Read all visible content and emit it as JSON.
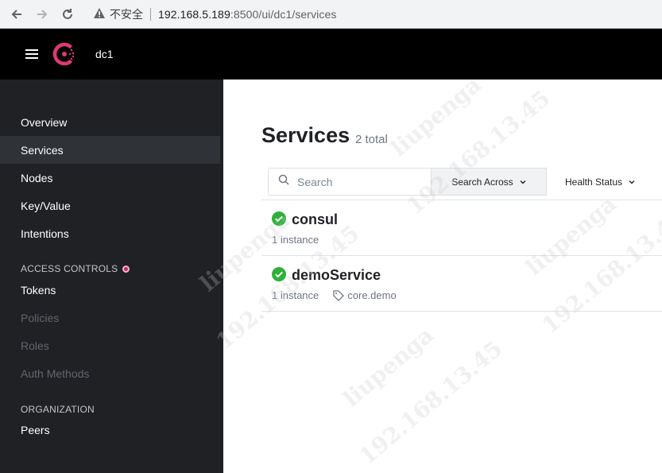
{
  "browser": {
    "security_label": "不安全",
    "url_host": "192.168.5.189",
    "url_rest": ":8500/ui/dc1/services"
  },
  "header": {
    "datacenter": "dc1"
  },
  "sidebar": {
    "items": [
      {
        "label": "Overview"
      },
      {
        "label": "Services"
      },
      {
        "label": "Nodes"
      },
      {
        "label": "Key/Value"
      },
      {
        "label": "Intentions"
      }
    ],
    "access_controls_heading": "ACCESS CONTROLS",
    "access_items": [
      {
        "label": "Tokens"
      },
      {
        "label": "Policies"
      },
      {
        "label": "Roles"
      },
      {
        "label": "Auth Methods"
      }
    ],
    "organization_heading": "ORGANIZATION",
    "organization_items": [
      {
        "label": "Peers"
      }
    ]
  },
  "main": {
    "title": "Services",
    "total": "2 total",
    "search_placeholder": "Search",
    "search_across_label": "Search Across",
    "health_status_label": "Health Status",
    "services": [
      {
        "name": "consul",
        "instances": "1 instance",
        "tag": ""
      },
      {
        "name": "demoService",
        "instances": "1 instance",
        "tag": "core.demo"
      }
    ]
  },
  "watermark": {
    "name": "liupenga",
    "ip": "192.168.13.45"
  },
  "colors": {
    "brand": "#e03875",
    "passing": "#2eb039",
    "sidebar_bg": "#1f2124",
    "active_item_bg": "#2f3237"
  }
}
